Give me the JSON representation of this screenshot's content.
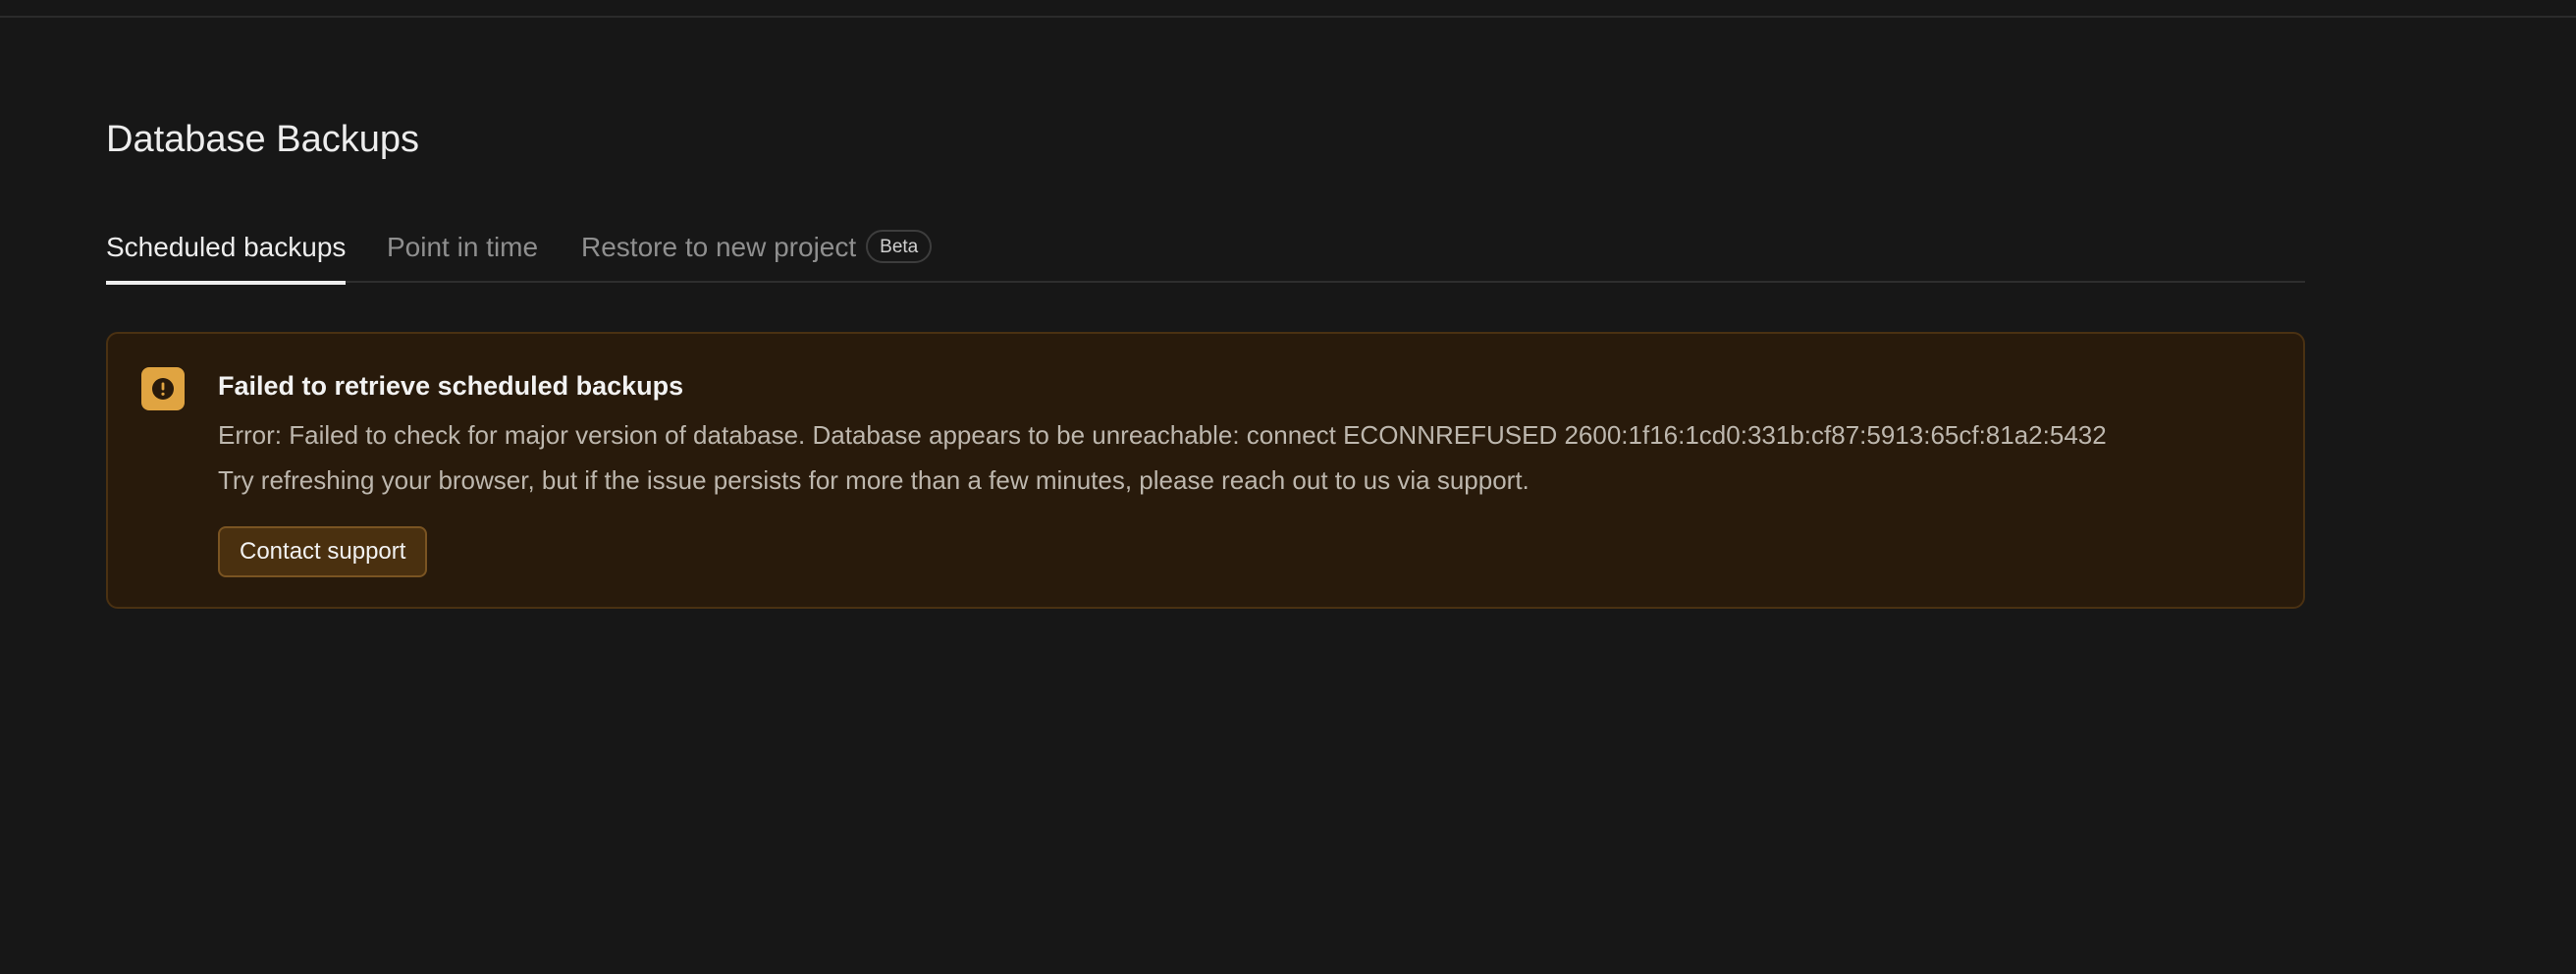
{
  "page": {
    "title": "Database Backups"
  },
  "tabs": [
    {
      "label": "Scheduled backups",
      "active": true
    },
    {
      "label": "Point in time",
      "active": false
    },
    {
      "label": "Restore to new project",
      "badge": "Beta",
      "active": false
    }
  ],
  "alert": {
    "icon": "exclamation-circle-icon",
    "title": "Failed to retrieve scheduled backups",
    "error_message": "Error: Failed to check for major version of database. Database appears to be unreachable: connect ECONNREFUSED 2600:1f16:1cd0:331b:cf87:5913:65cf:81a2:5432",
    "hint": "Try refreshing your browser, but if the issue persists for more than a few minutes, please reach out to us via support.",
    "action_label": "Contact support"
  },
  "colors": {
    "background": "#171717",
    "alert_background": "#281a0b",
    "alert_border": "#4a3112",
    "warning_accent": "#e0a441",
    "active_tab": "#ededed",
    "inactive_tab": "#8f8f8f"
  }
}
